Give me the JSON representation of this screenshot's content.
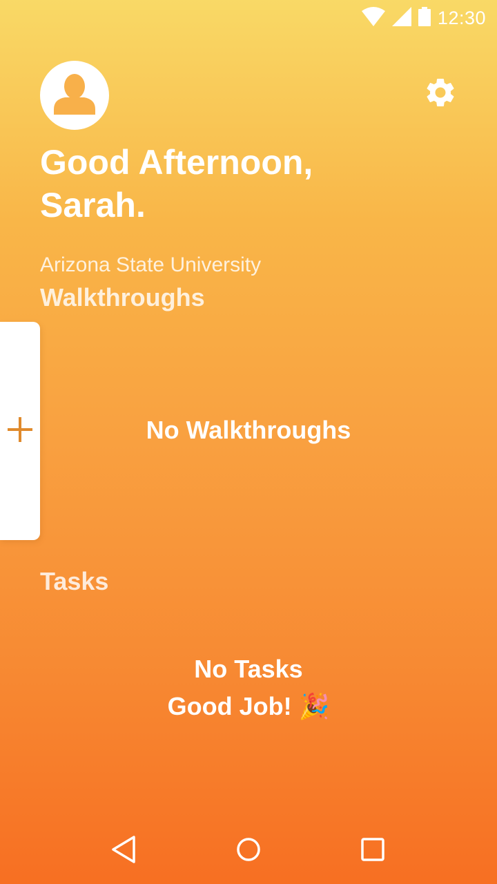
{
  "status_bar": {
    "time": "12:30",
    "icons": [
      "wifi-icon",
      "signal-icon",
      "battery-icon"
    ]
  },
  "header": {
    "avatar_icon": "person-icon",
    "settings_icon": "gear-icon",
    "greeting_line1": "Good Afternoon,",
    "greeting_line2": "Sarah."
  },
  "organization": {
    "name": "Arizona State University"
  },
  "walkthroughs": {
    "title": "Walkthroughs",
    "empty_text": "No Walkthroughs",
    "add_icon": "plus-icon"
  },
  "tasks": {
    "title": "Tasks",
    "empty_line1": "No Tasks",
    "empty_line2": "Good Job! 🎉"
  },
  "nav": {
    "back_icon": "back-triangle-icon",
    "home_icon": "home-circle-icon",
    "recents_icon": "recents-square-icon"
  },
  "colors": {
    "gradient_top": "#f9d966",
    "gradient_bottom": "#f76f22",
    "accent": "#e08a2c"
  }
}
